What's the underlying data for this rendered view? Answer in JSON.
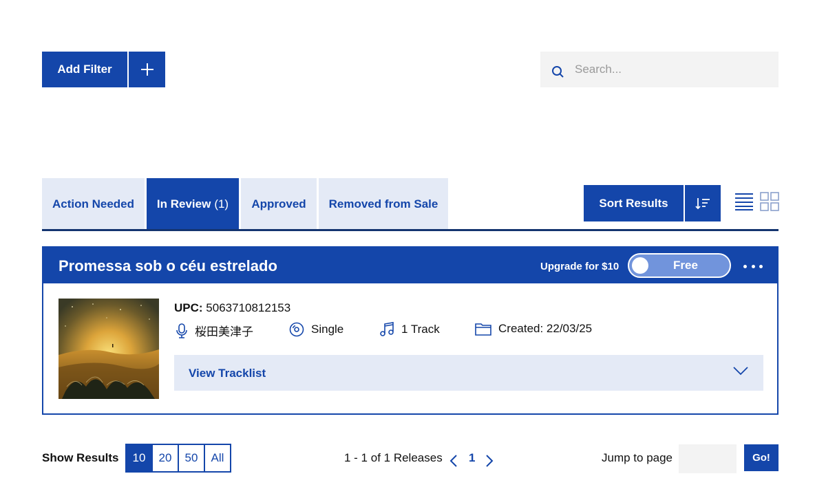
{
  "filters": {
    "add_filter_label": "Add Filter"
  },
  "search": {
    "placeholder": "Search..."
  },
  "tabs": [
    {
      "label": "Action Needed",
      "count": ""
    },
    {
      "label": "In Review",
      "count": "(1)"
    },
    {
      "label": "Approved",
      "count": ""
    },
    {
      "label": "Removed from Sale",
      "count": ""
    }
  ],
  "active_tab": "In Review",
  "sort": {
    "label": "Sort Results"
  },
  "release": {
    "title": "Promessa sob o céu estrelado",
    "upgrade_label": "Upgrade for $10",
    "plan_toggle_label": "Free",
    "upc_label": "UPC:",
    "upc_value": "5063710812153",
    "artist": "桜田美津子",
    "type": "Single",
    "tracks": "1 Track",
    "created": "Created: 22/03/25",
    "view_tracklist_label": "View Tracklist"
  },
  "pagination": {
    "show_results_label": "Show Results",
    "page_sizes": [
      "10",
      "20",
      "50",
      "All"
    ],
    "selected_page_size": "10",
    "range_text": "1 - 1 of 1 Releases",
    "current_page": "1",
    "jump_label": "Jump to page",
    "go_label": "Go!"
  },
  "colors": {
    "primary": "#1446aa",
    "tab_inactive_bg": "#e4eaf6",
    "search_bg": "#f3f3f3",
    "toggle_bg": "#7194dc"
  },
  "icons": [
    "plus-icon",
    "search-icon",
    "sort-direction-icon",
    "list-view-icon",
    "grid-view-icon",
    "more-options-icon",
    "microphone-icon",
    "disc-icon",
    "music-note-icon",
    "folder-icon",
    "chevron-down-icon",
    "chevron-left-icon",
    "chevron-right-icon"
  ]
}
